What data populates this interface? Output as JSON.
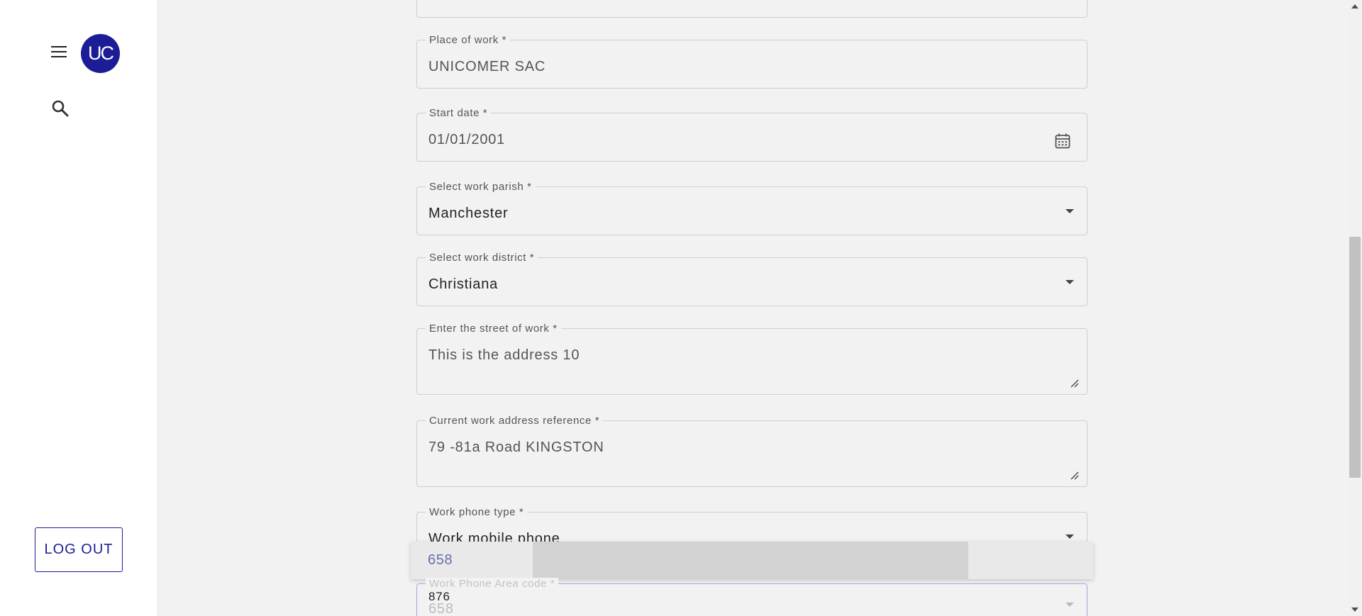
{
  "sidebar": {
    "avatar_text": "UC",
    "logout_label": "LOG OUT"
  },
  "form": {
    "place_of_work": {
      "label": "Place of work *",
      "value": "UNICOMER SAC"
    },
    "start_date": {
      "label": "Start date *",
      "value": "01/01/2001"
    },
    "work_parish": {
      "label": "Select work parish *",
      "value": "Manchester"
    },
    "work_district": {
      "label": "Select work district *",
      "value": "Christiana"
    },
    "street_of_work": {
      "label": "Enter the street of work *",
      "value": "This is the address 10"
    },
    "address_reference": {
      "label": "Current work address reference *",
      "value": "79 -81a Road KINGSTON"
    },
    "phone_type": {
      "label": "Work phone type *",
      "value": "Work mobile phone"
    },
    "area_code": {
      "label": "Work Phone Area code *",
      "value": "876",
      "ghost_value": "658"
    }
  },
  "dropdown": {
    "options": [
      "658"
    ]
  },
  "colors": {
    "brand": "#1a1d96",
    "focus_border": "#a9a6e2"
  }
}
